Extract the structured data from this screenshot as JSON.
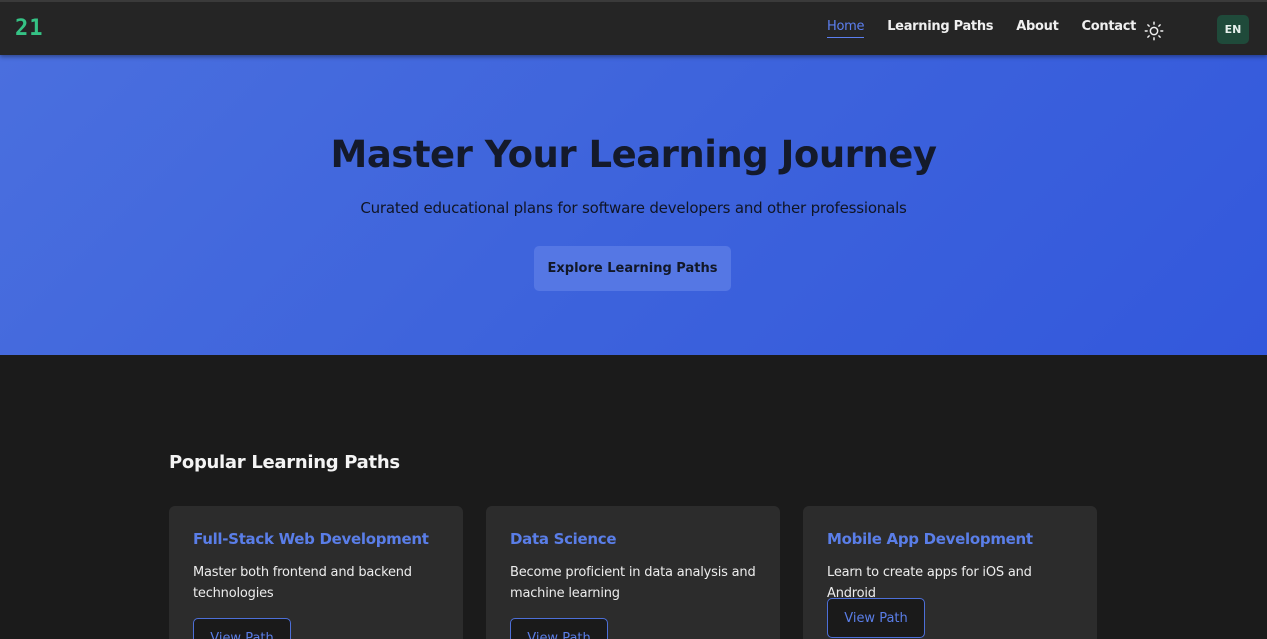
{
  "header": {
    "logo": "21",
    "nav": [
      {
        "label": "Home",
        "active": true
      },
      {
        "label": "Learning Paths",
        "active": false
      },
      {
        "label": "About",
        "active": false
      },
      {
        "label": "Contact",
        "active": false
      }
    ],
    "theme_icon": "sun-icon",
    "language": "EN"
  },
  "hero": {
    "title": "Master Your Learning Journey",
    "subtitle": "Curated educational plans for software developers and other professionals",
    "cta_label": "Explore Learning Paths"
  },
  "section": {
    "title": "Popular Learning Paths",
    "cards": [
      {
        "title": "Full-Stack Web Development",
        "description": "Master both frontend and backend technologies",
        "button_label": "View Path"
      },
      {
        "title": "Data Science",
        "description": "Become proficient in data analysis and machine learning",
        "button_label": "View Path"
      },
      {
        "title": "Mobile App Development",
        "description": "Learn to create apps for iOS and Android",
        "button_label": "View Path"
      }
    ]
  },
  "colors": {
    "accent": "#5a7ee8",
    "hero_bg": "#3d63dc",
    "logo": "#35c285",
    "background": "#1b1b1b"
  }
}
